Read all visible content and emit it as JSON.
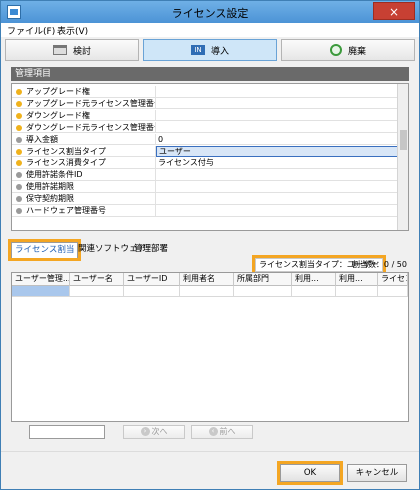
{
  "window": {
    "title": "ライセンス設定",
    "close_glyph": "×"
  },
  "menu": {
    "file": "ファイル(F)",
    "view": "表示(V)"
  },
  "toolbar": {
    "check": "検討",
    "import": "導入",
    "discard": "廃棄",
    "import_icon_text": "IN"
  },
  "section": {
    "title": "管理項目"
  },
  "properties": [
    {
      "name": "アップグレード権",
      "value": "",
      "dot": "#f0b21c"
    },
    {
      "name": "アップグレード元ライセンス管理番号",
      "value": "",
      "dot": "#f0b21c"
    },
    {
      "name": "ダウングレード権",
      "value": "",
      "dot": "#f0b21c"
    },
    {
      "name": "ダウングレード元ライセンス管理番号",
      "value": "",
      "dot": "#f0b21c"
    },
    {
      "name": "導入金額",
      "value": "0",
      "dot": "#9a9a9a"
    },
    {
      "name": "ライセンス割当タイプ",
      "value": "ユーザー",
      "dot": "#f0b21c"
    },
    {
      "name": "ライセンス消費タイプ",
      "value": "ライセンス付与",
      "dot": "#f0b21c"
    },
    {
      "name": "使用許諾条件ID",
      "value": "",
      "dot": "#9a9a9a"
    },
    {
      "name": "使用許諾期限",
      "value": "",
      "dot": "#9a9a9a"
    },
    {
      "name": "保守契約期限",
      "value": "",
      "dot": "#9a9a9a"
    },
    {
      "name": "ハードウェア管理番号",
      "value": "",
      "dot": "#9a9a9a"
    }
  ],
  "tabs": {
    "assign": "ライセンス割当",
    "related": "関連ソフトウェア",
    "dept": "管理部署"
  },
  "info": {
    "type_badge": "ライセンス割当タイプ：ユーザー",
    "count": "割当数：0 / 50"
  },
  "table": {
    "headers": [
      "ユーザー管理...",
      "ユーザー名",
      "ユーザーID",
      "利用者名",
      "所属部門",
      "利用...",
      "利用...",
      "ライセンス..."
    ]
  },
  "pager": {
    "next": "次へ",
    "prev": "前へ"
  },
  "buttons": {
    "ok": "OK",
    "cancel": "キャンセル"
  }
}
